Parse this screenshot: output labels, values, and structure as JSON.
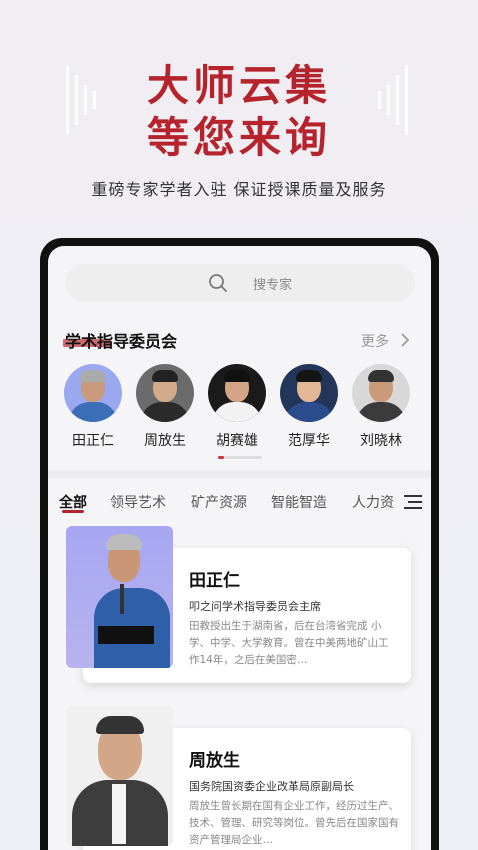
{
  "hero": {
    "line1": "大师云集",
    "line2": "等您来询",
    "subtitle": "重磅专家学者入驻 保证授课质量及服务"
  },
  "search": {
    "placeholder": "搜专家"
  },
  "committee": {
    "title": "学术指导委员会",
    "more": "更多",
    "experts": [
      {
        "name": "田正仁"
      },
      {
        "name": "周放生"
      },
      {
        "name": "胡赛雄"
      },
      {
        "name": "范厚华"
      },
      {
        "name": "刘晓林"
      }
    ]
  },
  "tabs": [
    "全部",
    "领导艺术",
    "矿产资源",
    "智能智造",
    "人力资"
  ],
  "cards": [
    {
      "name": "田正仁",
      "title": "叩之问学术指导委员会主席",
      "desc": "田教授出生于湖南省，后在台湾省完成 小学、中学、大学教育。曾在中美两地矿山工 作14年，之后在美国密…"
    },
    {
      "name": "周放生",
      "title": "国务院国资委企业改革局原副局长",
      "desc": "周放生曾长期在国有企业工作，经历过生产、技术、管理、研究等岗位。曾先后在国家国有资产管理局企业…"
    }
  ],
  "colors": {
    "accent": "#b5242c"
  }
}
